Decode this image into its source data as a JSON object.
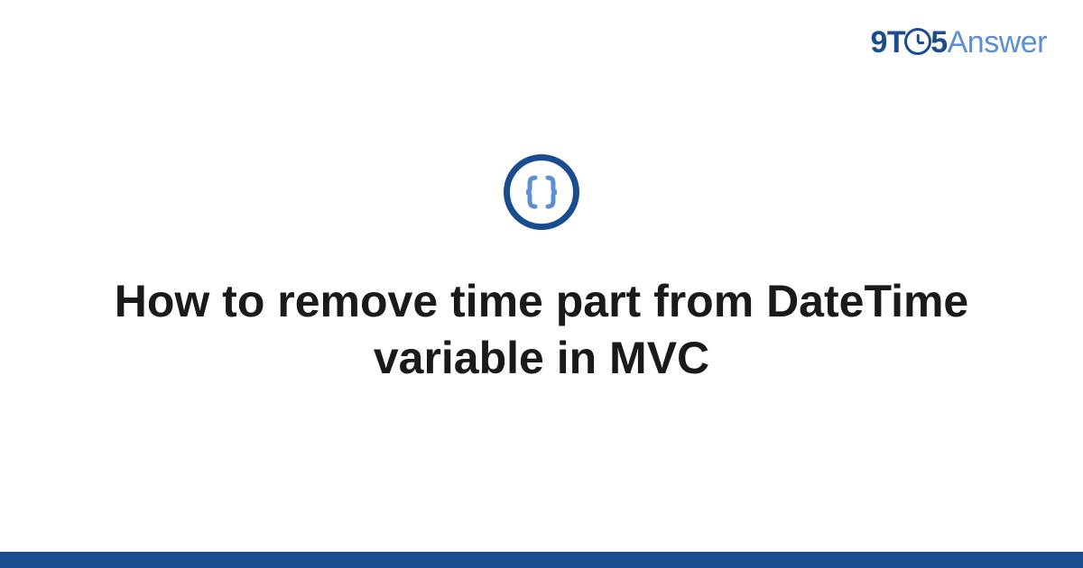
{
  "logo": {
    "part1": "9T",
    "part2": "5",
    "part3": "Answer"
  },
  "icon": {
    "name": "code-braces-icon"
  },
  "title": "How to remove time part from DateTime variable in MVC",
  "colors": {
    "primary": "#1a4d8f",
    "secondary": "#5a8fd4"
  }
}
